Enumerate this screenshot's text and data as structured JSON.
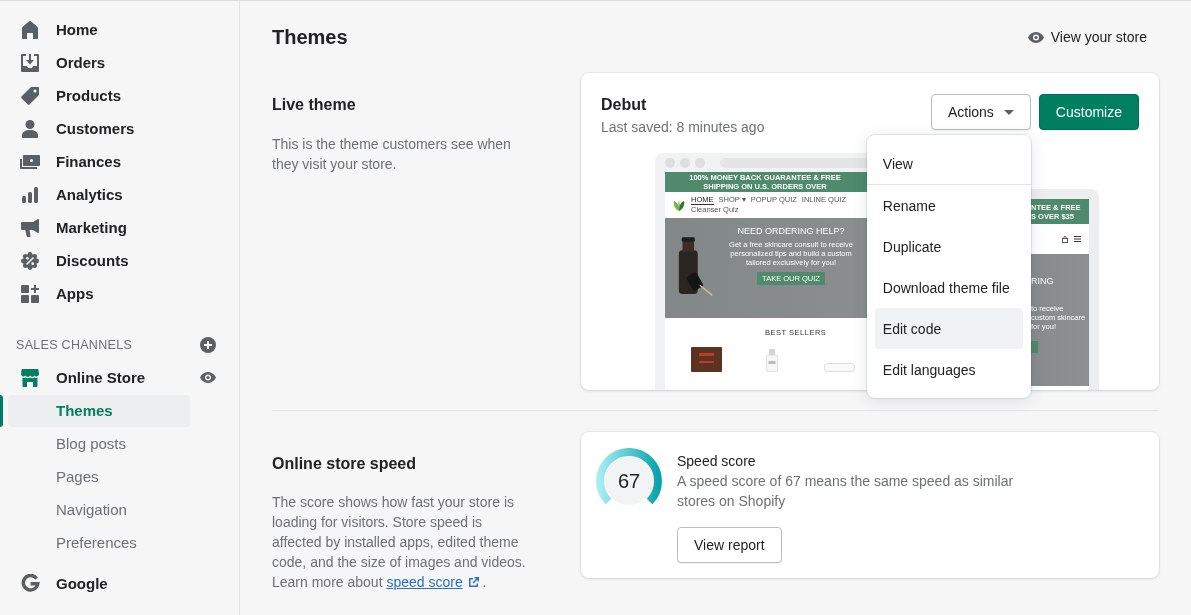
{
  "sidebar": {
    "items": [
      {
        "label": "Home"
      },
      {
        "label": "Orders"
      },
      {
        "label": "Products"
      },
      {
        "label": "Customers"
      },
      {
        "label": "Finances"
      },
      {
        "label": "Analytics"
      },
      {
        "label": "Marketing"
      },
      {
        "label": "Discounts"
      },
      {
        "label": "Apps"
      }
    ],
    "sales_channels": {
      "title": "SALES CHANNELS",
      "store": {
        "label": "Online Store",
        "children": [
          {
            "label": "Themes",
            "selected": true
          },
          {
            "label": "Blog posts",
            "selected": false
          },
          {
            "label": "Pages",
            "selected": false
          },
          {
            "label": "Navigation",
            "selected": false
          },
          {
            "label": "Preferences",
            "selected": false
          }
        ]
      },
      "other": [
        {
          "label": "Google"
        }
      ]
    }
  },
  "page": {
    "title": "Themes",
    "view_store": "View your store"
  },
  "live_theme": {
    "title": "Live theme",
    "description": "This is the theme customers see when they visit your store.",
    "card": {
      "name": "Debut",
      "last_saved": "Last saved: 8 minutes ago",
      "actions_button": "Actions",
      "customize_button": "Customize",
      "preview": {
        "desktop": {
          "banner": "100% MONEY BACK GUARANTEE & FREE SHIPPING ON U.S. ORDERS OVER",
          "nav": [
            {
              "label": "HOME",
              "selected": true
            },
            {
              "label": "SHOP ▾",
              "selected": false
            },
            {
              "label": "POPUP QUIZ",
              "selected": false
            },
            {
              "label": "INLINE QUIZ",
              "selected": false
            },
            {
              "label": "Cleanser Quiz",
              "selected": false
            }
          ],
          "hero_title": "NEED ORDERING HELP?",
          "hero_lines": [
            "Get a free skincare consult to receive personalized tips and build a custom",
            "tailored exclusively for you!"
          ],
          "hero_button": "TAKE OUR QUIZ",
          "section_title": "BEST SELLERS"
        },
        "mobile": {
          "banner_lines": [
            "NTEE & FREE",
            "S OVER $35"
          ],
          "hero_title": "RING",
          "hero_lines": [
            "to receive",
            "custom skincare",
            "for you!"
          ]
        }
      },
      "menu": [
        {
          "items": [
            {
              "label": "View",
              "highlighted": false
            }
          ]
        },
        {
          "items": [
            {
              "label": "Rename",
              "highlighted": false
            },
            {
              "label": "Duplicate",
              "highlighted": false
            },
            {
              "label": "Download theme file",
              "highlighted": false
            },
            {
              "label": "Edit code",
              "highlighted": true
            },
            {
              "label": "Edit languages",
              "highlighted": false
            }
          ]
        }
      ]
    }
  },
  "store_speed": {
    "title": "Online store speed",
    "description": "The score shows how fast your store is loading for visitors. Store speed is affected by installed apps, edited theme code, and the size of images and videos. Learn more about",
    "link": "speed score",
    "trailing": ".",
    "card": {
      "score": "67",
      "title": "Speed score",
      "description": "A speed score of 67 means the same speed as similar stores on Shopify",
      "button": "View report"
    }
  }
}
